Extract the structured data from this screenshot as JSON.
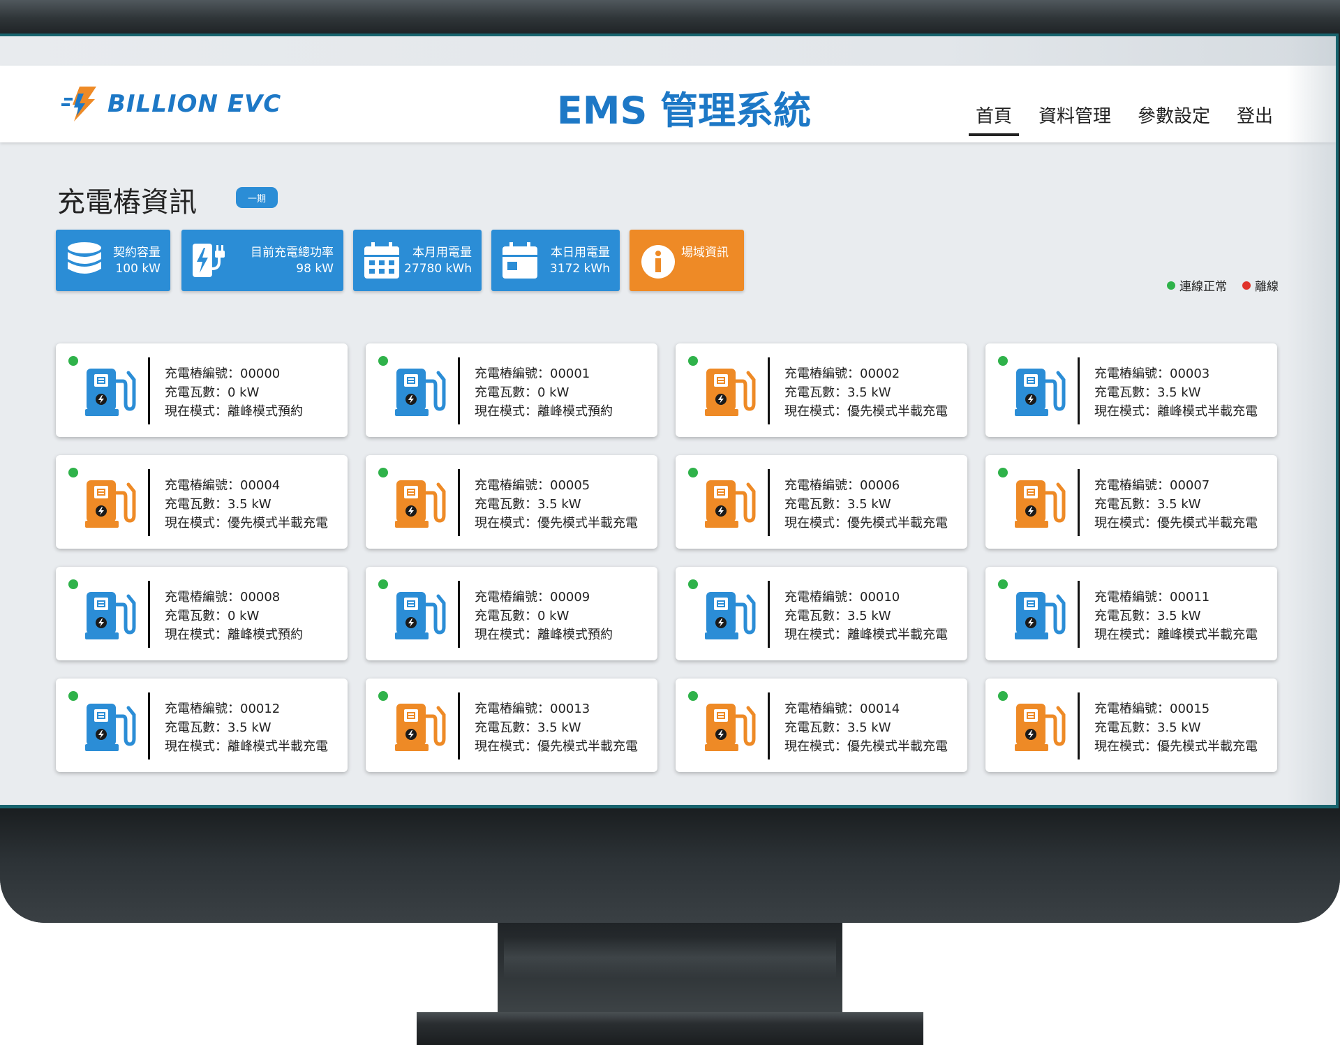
{
  "header": {
    "logo_text": "BILLION EVC",
    "title": "EMS 管理系統",
    "nav": [
      "首頁",
      "資料管理",
      "參數設定",
      "登出"
    ]
  },
  "section": {
    "title": "充電樁資訊",
    "phase_badge": "一期"
  },
  "stats": [
    {
      "label": "契約容量",
      "value": "100 kW",
      "icon": "database-icon"
    },
    {
      "label": "目前充電總功率",
      "value": "98 kW",
      "icon": "ev-plug-icon"
    },
    {
      "label": "本月用電量",
      "value": "27780 kWh",
      "icon": "calendar-month-icon"
    },
    {
      "label": "本日用電量",
      "value": "3172 kWh",
      "icon": "calendar-day-icon"
    },
    {
      "label": "場域資訊",
      "value": "",
      "icon": "info-icon"
    }
  ],
  "legend": {
    "online": "連線正常",
    "offline": "離線"
  },
  "colors": {
    "accent": "#1d78c6",
    "blue": "#2b8dd6",
    "orange": "#ee8a26",
    "online": "#2fb24a",
    "offline": "#e0322b"
  },
  "chargers": [
    {
      "id_line": "充電樁編號：00000",
      "power_line": "充電瓦數：0 kW",
      "mode_line": "現在模式：離峰模式預約",
      "color": "blue"
    },
    {
      "id_line": "充電樁編號：00001",
      "power_line": "充電瓦數：0 kW",
      "mode_line": "現在模式：離峰模式預約",
      "color": "blue"
    },
    {
      "id_line": "充電樁編號：00002",
      "power_line": "充電瓦數：3.5 kW",
      "mode_line": "現在模式：優先模式半載充電",
      "color": "orange"
    },
    {
      "id_line": "充電樁編號：00003",
      "power_line": "充電瓦數：3.5 kW",
      "mode_line": "現在模式：離峰模式半載充電",
      "color": "blue"
    },
    {
      "id_line": "充電樁編號：00004",
      "power_line": "充電瓦數：3.5 kW",
      "mode_line": "現在模式：優先模式半載充電",
      "color": "orange"
    },
    {
      "id_line": "充電樁編號：00005",
      "power_line": "充電瓦數：3.5 kW",
      "mode_line": "現在模式：優先模式半載充電",
      "color": "orange"
    },
    {
      "id_line": "充電樁編號：00006",
      "power_line": "充電瓦數：3.5 kW",
      "mode_line": "現在模式：優先模式半載充電",
      "color": "orange"
    },
    {
      "id_line": "充電樁編號：00007",
      "power_line": "充電瓦數：3.5 kW",
      "mode_line": "現在模式：優先模式半載充電",
      "color": "orange"
    },
    {
      "id_line": "充電樁編號：00008",
      "power_line": "充電瓦數：0 kW",
      "mode_line": "現在模式：離峰模式預約",
      "color": "blue"
    },
    {
      "id_line": "充電樁編號：00009",
      "power_line": "充電瓦數：0 kW",
      "mode_line": "現在模式：離峰模式預約",
      "color": "blue"
    },
    {
      "id_line": "充電樁編號：00010",
      "power_line": "充電瓦數：3.5 kW",
      "mode_line": "現在模式：離峰模式半載充電",
      "color": "blue"
    },
    {
      "id_line": "充電樁編號：00011",
      "power_line": "充電瓦數：3.5 kW",
      "mode_line": "現在模式：離峰模式半載充電",
      "color": "blue"
    },
    {
      "id_line": "充電樁編號：00012",
      "power_line": "充電瓦數：3.5 kW",
      "mode_line": "現在模式：離峰模式半載充電",
      "color": "blue"
    },
    {
      "id_line": "充電樁編號：00013",
      "power_line": "充電瓦數：3.5 kW",
      "mode_line": "現在模式：優先模式半載充電",
      "color": "orange"
    },
    {
      "id_line": "充電樁編號：00014",
      "power_line": "充電瓦數：3.5 kW",
      "mode_line": "現在模式：優先模式半載充電",
      "color": "orange"
    },
    {
      "id_line": "充電樁編號：00015",
      "power_line": "充電瓦數：3.5 kW",
      "mode_line": "現在模式：優先模式半載充電",
      "color": "orange"
    }
  ]
}
